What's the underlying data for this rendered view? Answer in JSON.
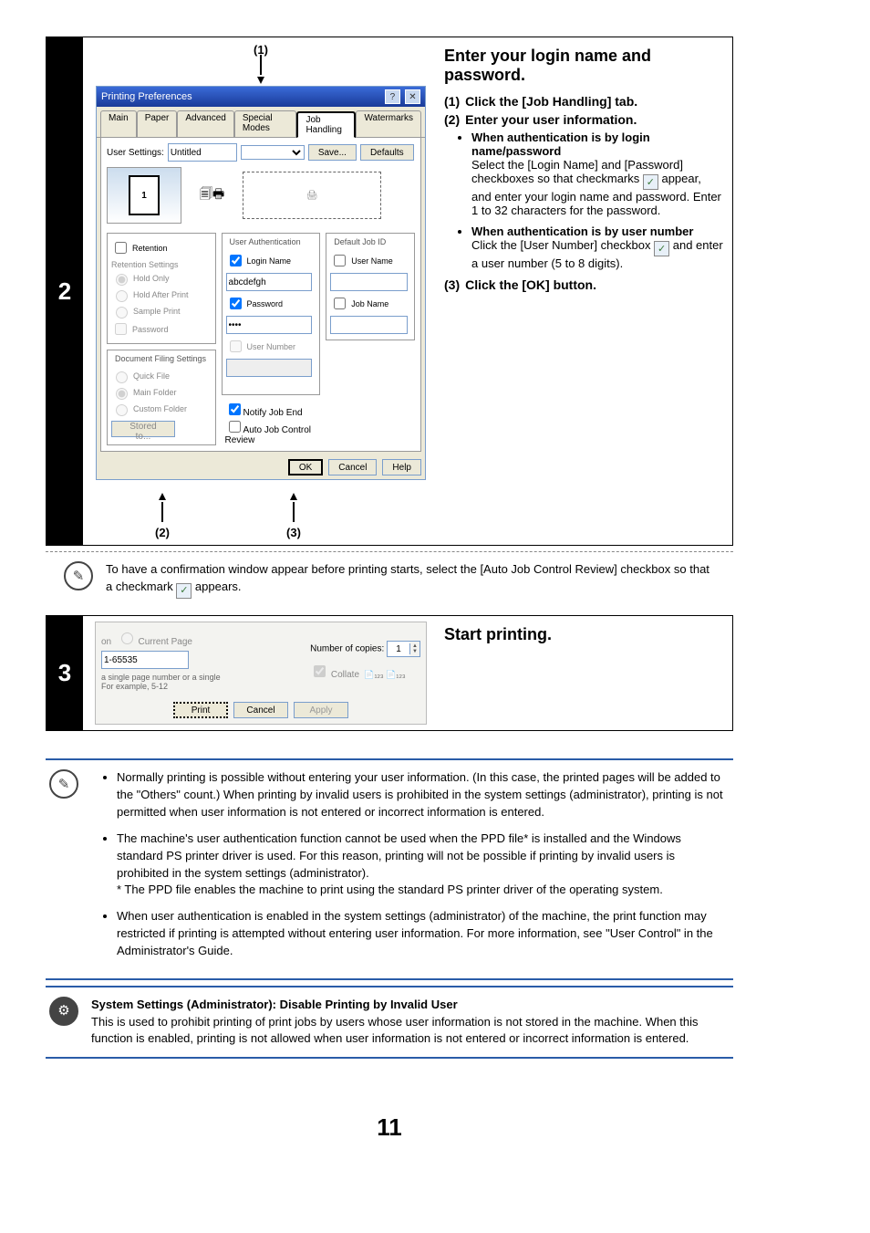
{
  "page_number": "11",
  "step2": {
    "number": "2",
    "callout1": "(1)",
    "callout2": "(2)",
    "callout3": "(3)",
    "dialog": {
      "title": "Printing Preferences",
      "tabs": [
        "Main",
        "Paper",
        "Advanced",
        "Special Modes",
        "Job Handling",
        "Watermarks"
      ],
      "active_tab": "Job Handling",
      "user_settings_label": "User Settings:",
      "user_settings_value": "Untitled",
      "save_btn": "Save...",
      "defaults_btn": "Defaults",
      "preview_num": "1",
      "groups": {
        "retention": {
          "title": "Retention",
          "chk": "Retention",
          "subtitle": "Retention Settings",
          "opt1": "Hold Only",
          "opt2": "Hold After Print",
          "opt3": "Sample Print",
          "pw": "Password"
        },
        "docfiling": {
          "title": "Document Filing Settings",
          "opt1": "Quick File",
          "opt2": "Main Folder",
          "opt3": "Custom Folder",
          "btn": "Stored to..."
        },
        "userauth": {
          "title": "User Authentication",
          "login_chk": "Login Name",
          "login_val": "abcdefgh",
          "pw_chk": "Password",
          "pw_val": "••••",
          "un_chk": "User Number"
        },
        "notify": "Notify Job End",
        "autoreview": "Auto Job Control Review",
        "defaultjob": {
          "title": "Default Job ID",
          "un": "User Name",
          "jn": "Job Name"
        }
      },
      "ok": "OK",
      "cancel": "Cancel",
      "help": "Help"
    },
    "instructions": {
      "heading": "Enter your login name and password.",
      "p1": "Click the [Job Handling] tab.",
      "p2": "Enter your user information.",
      "b1_title": "When authentication is by login name/password",
      "b1_body1": "Select the [Login Name] and [Password] checkboxes so that checkmarks ",
      "b1_body2": " appear, and enter your login name and password. Enter 1 to 32 characters for the password.",
      "b2_title": "When authentication is by user number",
      "b2_body1": "Click the [User Number] checkbox ",
      "b2_body2": " and enter a user number (5 to 8 digits).",
      "p3": "Click the [OK] button."
    },
    "note1a": "To have a confirmation window appear before printing starts, select the [Auto Job Control Review] checkbox so that a checkmark ",
    "note1b": " appears."
  },
  "step3": {
    "number": "3",
    "heading": "Start printing.",
    "dialog": {
      "cp_radio": "Current Page",
      "range_val": "1-65535",
      "desc1": "a single page number or a single",
      "desc2": "For example, 5-12",
      "copies_lbl": "Number of copies:",
      "copies_val": "1",
      "collate": "Collate",
      "print": "Print",
      "cancel": "Cancel",
      "apply": "Apply"
    }
  },
  "info": {
    "b1": "Normally printing is possible without entering your user information. (In this case, the printed pages will be added to the \"Others\" count.) When printing by invalid users is prohibited in the system settings (administrator), printing is not permitted when user information is not entered or incorrect information is entered.",
    "b2": "The machine's user authentication function cannot be used when the PPD file* is installed and the Windows standard PS printer driver is used. For this reason, printing will not be possible if printing by invalid users is prohibited in the system settings (administrator).",
    "b2_sub": "* The PPD file enables the machine to print using the standard PS printer driver of the operating system.",
    "b3": "When user authentication is enabled in the system settings (administrator) of the machine, the print function may restricted if printing is attempted without entering user information. For more information, see \"User Control\" in the Administrator's Guide."
  },
  "admin": {
    "title": "System Settings (Administrator): Disable Printing by Invalid User",
    "body": "This is used to prohibit printing of print jobs by users whose user information is not stored in the machine. When this function is enabled, printing is not allowed when user information is not entered or incorrect information is entered."
  }
}
